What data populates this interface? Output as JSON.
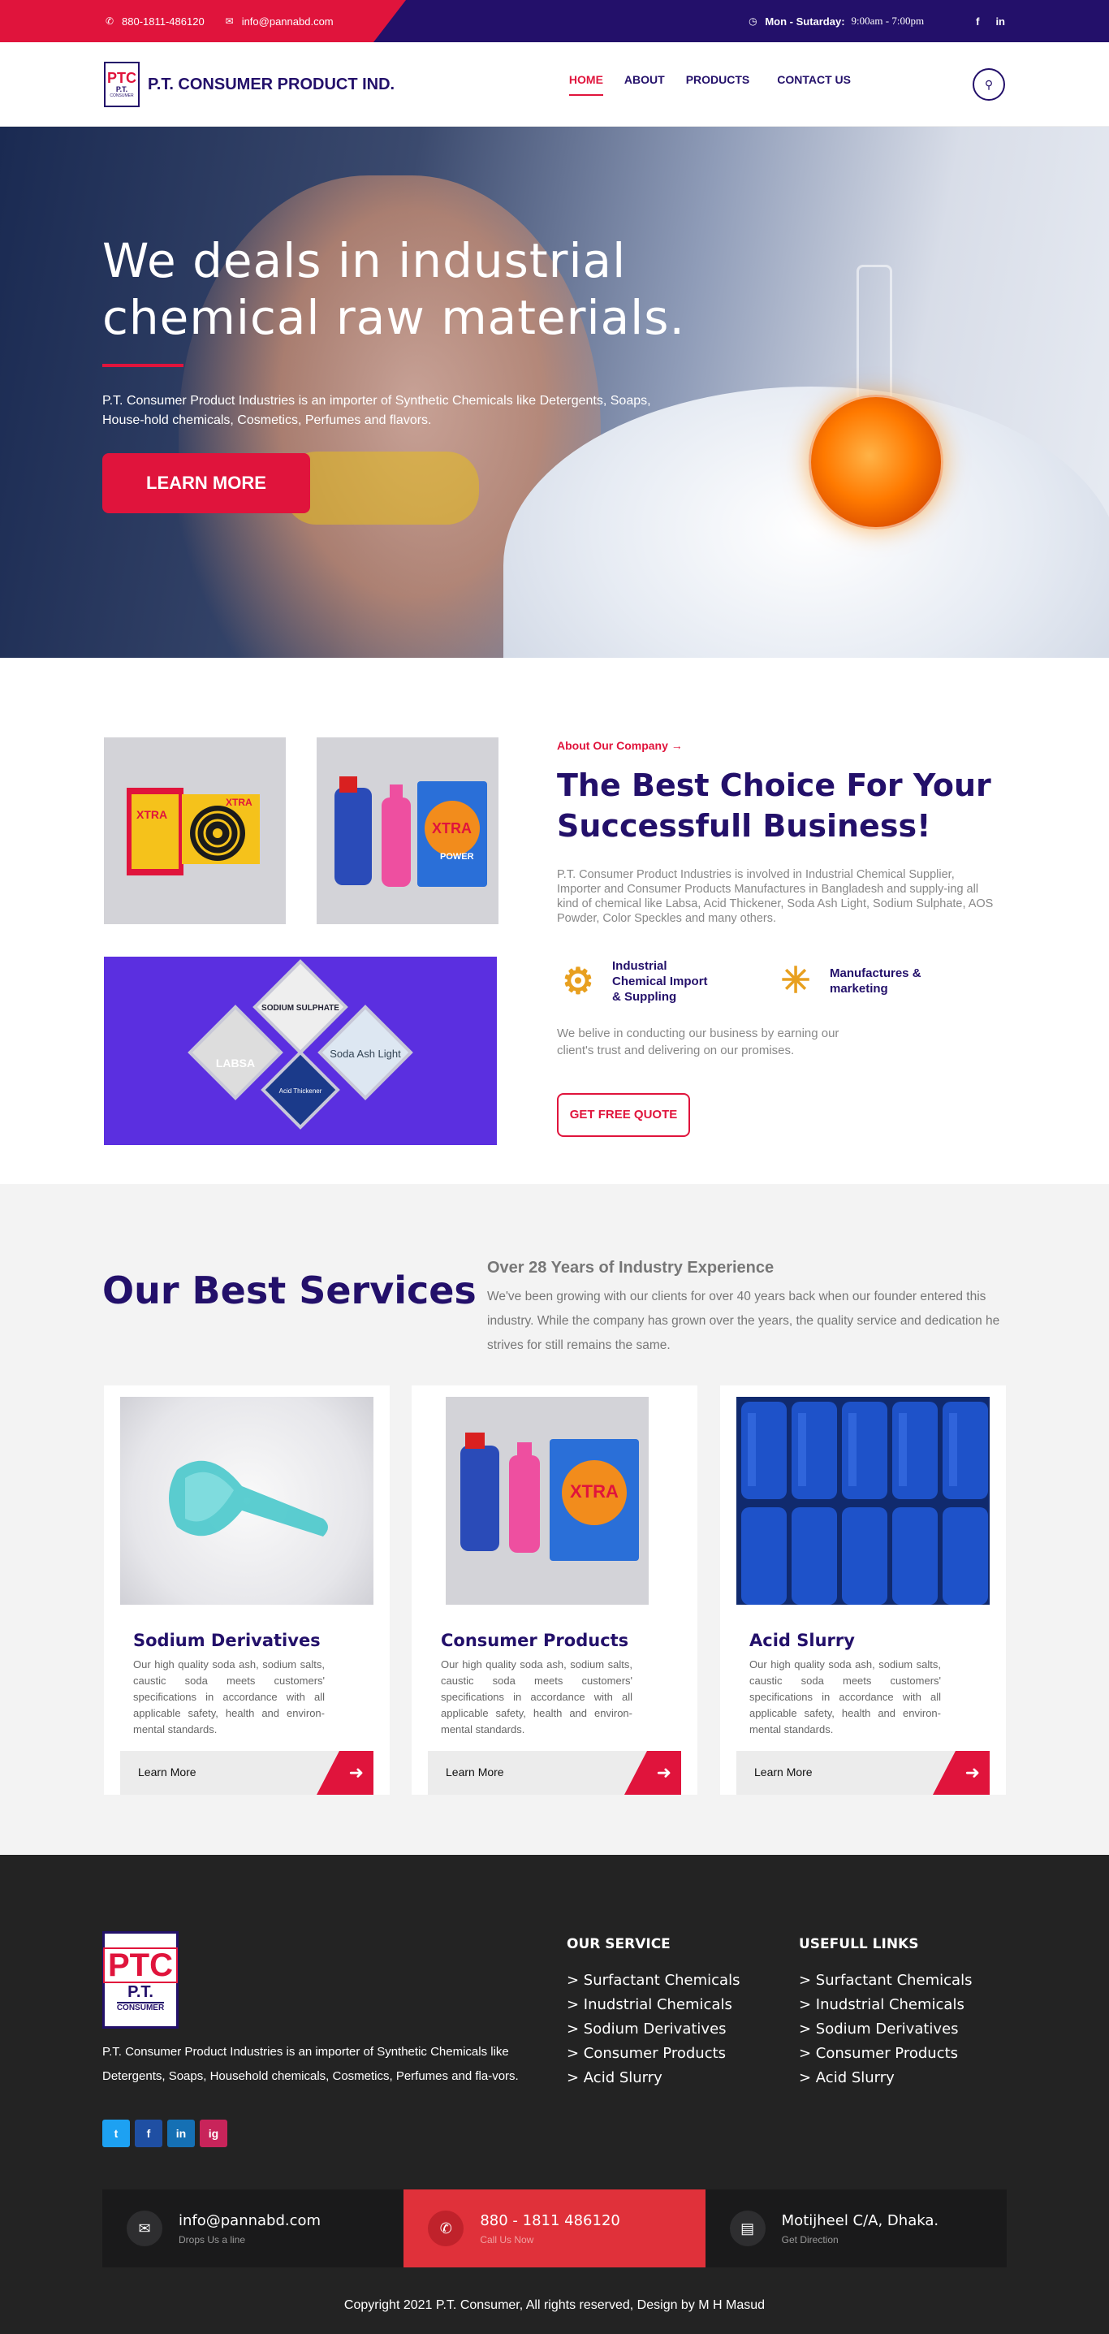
{
  "topbar": {
    "phone": "880-1811-486120",
    "email": "info@pannabd.com",
    "hours_label": "Mon - Sutarday:",
    "hours_value": "9:00am - 7:00pm",
    "social": [
      "f",
      "in"
    ]
  },
  "nav": {
    "logo": {
      "line1": "PTC",
      "line2": "P.T.",
      "line3": "CONSUMER"
    },
    "brand": "P.T. CONSUMER PRODUCT IND.",
    "items": [
      "HOME",
      "ABOUT",
      "PRODUCTS",
      "CONTACT US"
    ],
    "active": "HOME"
  },
  "hero": {
    "title": "We deals in industrial chemical raw materials.",
    "text": "P.T. Consumer Product Industries is an importer of Synthetic Chemicals like Detergents, Soaps, House-hold chemicals, Cosmetics, Perfumes and flavors.",
    "button": "LEARN MORE"
  },
  "about": {
    "tag": "About Our Company →",
    "title": "The Best Choice For Your Successfull Business!",
    "desc": "P.T. Consumer Product Industries is involved in Industrial Chemical Supplier, Importer and Consumer Products Manufactures in Bangladesh and supply-ing all kind of chemical like Labsa, Acid Thickener, Soda Ash Light, Sodium Sulphate, AOS Powder, Color Speckles and many others.",
    "features": [
      "Industrial Chemical Import & Suppling",
      "Manufactures & marketing"
    ],
    "desc2": "We belive in conducting our business by earning our client's trust and delivering on our promises.",
    "button": "GET FREE QUOTE",
    "diamond_labels": [
      "SODIUM SULPHATE",
      "LABSA",
      "Soda Ash Light",
      "Acid Thickener"
    ],
    "product_label": "X-TRA POWER"
  },
  "services": {
    "title": "Our Best Services",
    "subtitle": "Over 28 Years of Industry Experience",
    "text": "We've been growing with our clients for over 40 years back when our founder entered this industry. While the company has grown over the years, the quality service and dedication he strives for still remains the same.",
    "cards": [
      {
        "title": "Sodium Derivatives",
        "text": "Our high quality soda ash, sodium salts, caustic soda meets customers' specifications in accordance with all applicable safety, health and environ-mental standards.",
        "more": "Learn More"
      },
      {
        "title": "Consumer Products",
        "text": "Our high quality soda ash, sodium salts, caustic soda meets customers' specifications in accordance with all applicable safety, health and environ-mental standards.",
        "more": "Learn More"
      },
      {
        "title": "Acid Slurry",
        "text": "Our high quality soda ash, sodium salts, caustic soda meets customers' specifications in accordance with all applicable safety, health and environ-mental standards.",
        "more": "Learn More"
      }
    ]
  },
  "footer": {
    "logo": {
      "line1": "PTC",
      "line2": "P.T.",
      "line3": "CONSUMER"
    },
    "desc": "P.T. Consumer Product Industries is an importer of Synthetic Chemicals like Detergents, Soaps, Household chemicals, Cosmetics, Perfumes and fla-vors.",
    "social": [
      "t",
      "f",
      "in",
      "ig"
    ],
    "col1": {
      "title": "OUR SERVICE",
      "items": [
        "> Surfactant Chemicals",
        "> Inudstrial Chemicals",
        "> Sodium Derivatives",
        "> Consumer Products",
        "> Acid Slurry"
      ]
    },
    "col2": {
      "title": "USEFULL LINKS",
      "items": [
        "> Surfactant Chemicals",
        "> Inudstrial Chemicals",
        "> Sodium Derivatives",
        "> Consumer Products",
        "> Acid Slurry"
      ]
    },
    "contact": [
      {
        "title": "info@pannabd.com",
        "sub": "Drops Us a line"
      },
      {
        "title": "880 - 1811 486120",
        "sub": "Call Us Now"
      },
      {
        "title": "Motijheel C/A, Dhaka.",
        "sub": "Get Direction"
      }
    ],
    "copyright": "Copyright 2021 P.T. Consumer,  All rights reserved, Design by M H Masud"
  },
  "colors": {
    "primary": "#23106a",
    "accent": "#e0143c",
    "footer": "#232323"
  }
}
